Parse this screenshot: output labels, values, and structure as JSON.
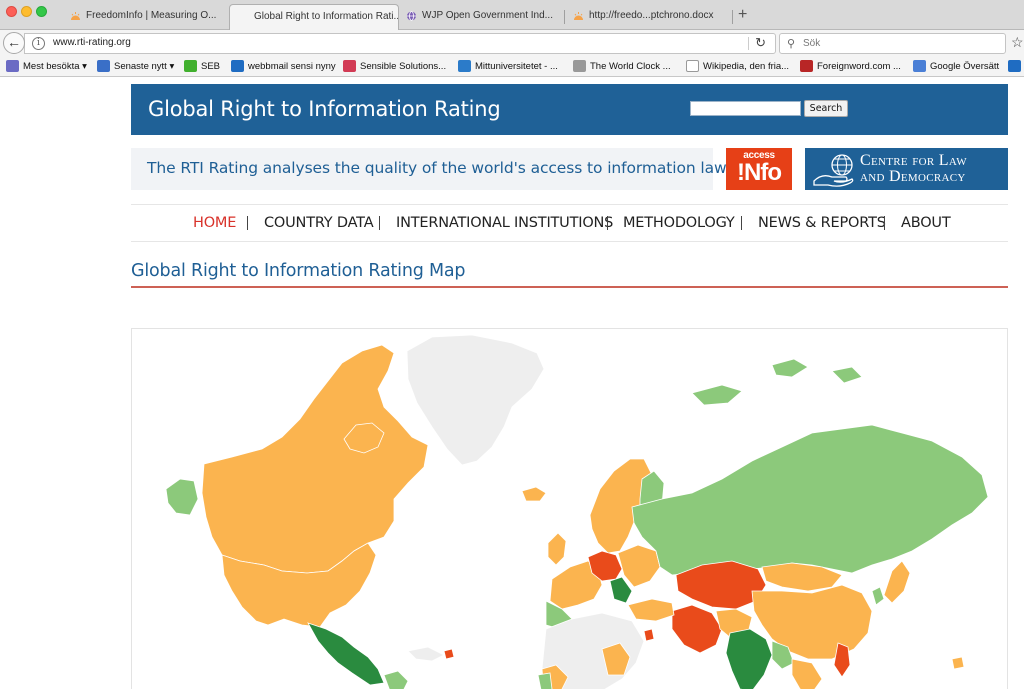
{
  "browser": {
    "tabs": [
      {
        "label": "FreedomInfo | Measuring O...",
        "active": false
      },
      {
        "label": "Global Right to Information Rati...",
        "active": true
      },
      {
        "label": "WJP Open Government Ind...",
        "active": false
      },
      {
        "label": "http://freedo...ptchrono.docx",
        "active": false
      }
    ],
    "url": "www.rti-rating.org",
    "search_placeholder": "Sök",
    "bookmarks": [
      {
        "label": "Mest besökta",
        "icon": "folder-icon",
        "color": "#6b6bc4"
      },
      {
        "label": "Senaste nytt",
        "icon": "rss-icon",
        "color": "#3a6fc7"
      },
      {
        "label": "SEB",
        "icon": "seb-icon",
        "color": "#41b02e"
      },
      {
        "label": "webbmail sensi nyny",
        "icon": "outlook-icon",
        "color": "#1f6cc2"
      },
      {
        "label": "Sensible Solutions...",
        "icon": "wifi-icon",
        "color": "#d23b55"
      },
      {
        "label": "Mittuniversitetet - ...",
        "icon": "university-icon",
        "color": "#2b7bc9"
      },
      {
        "label": "The World Clock ...",
        "icon": "clock-icon",
        "color": "#999999"
      },
      {
        "label": "Wikipedia, den fria...",
        "icon": "wikipedia-icon",
        "color": "#333333"
      },
      {
        "label": "Foreignword.com ...",
        "icon": "foreignword-icon",
        "color": "#b82626"
      },
      {
        "label": "Google Översätt",
        "icon": "translate-icon",
        "color": "#4a7fd6"
      }
    ]
  },
  "site": {
    "title": "Global Right to Information Rating",
    "search_button": "Search",
    "tagline": "The RTI Rating analyses the quality of the world's access to information laws",
    "logo_access_top": "access",
    "logo_access_bottom": "!Nfo",
    "logo_cld_line1": "Centre for Law",
    "logo_cld_line2": "and Democracy",
    "nav": [
      {
        "label": "HOME",
        "active": true
      },
      {
        "label": "COUNTRY DATA",
        "active": false
      },
      {
        "label": "INTERNATIONAL INSTITUTIONS",
        "active": false
      },
      {
        "label": "METHODOLOGY",
        "active": false
      },
      {
        "label": "NEWS & REPORTS",
        "active": false
      },
      {
        "label": "ABOUT",
        "active": false
      }
    ],
    "page_heading": "Global Right to Information Rating Map"
  },
  "map_colors": {
    "no_law": "#eeeeee",
    "weak": "#e94b1b",
    "moderate": "#fbb44f",
    "good": "#8cc97b",
    "strong": "#2a8b3f",
    "border": "#ffffff"
  }
}
